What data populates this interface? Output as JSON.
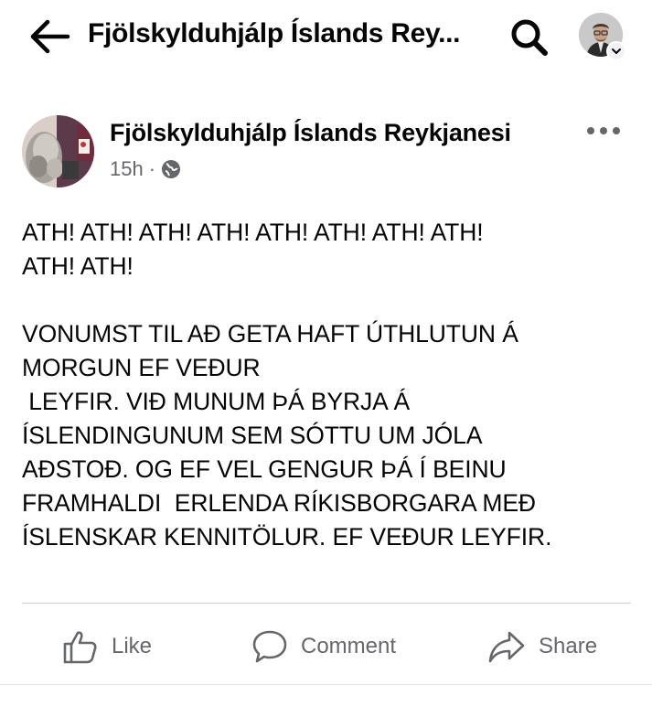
{
  "header": {
    "title": "Fjölskylduhjálp Íslands Rey...",
    "back_icon": "arrow-left-icon",
    "search_icon": "search-icon",
    "profile_icon": "avatar"
  },
  "post": {
    "page_name": "Fjölskylduhjálp Íslands Reykjanesi",
    "time": "15h",
    "separator": "·",
    "audience_icon": "globe-icon",
    "more_icon": "more-horizontal-icon",
    "body": "ATH! ATH! ATH! ATH! ATH! ATH! ATH! ATH!\nATH! ATH!\n\nVONUMST TIL AÐ GETA HAFT ÚTHLUTUN Á\nMORGUN EF VEÐUR\n LEYFIR. VIÐ MUNUM ÞÁ BYRJA Á\nÍSLENDINGUNUM SEM SÓTTU UM JÓLA\nAÐSTOÐ. OG EF VEL GENGUR ÞÁ Í BEINU\nFRAMHALDI  ERLENDA RÍKISBORGARA MEÐ\nÍSLENSKAR KENNITÖLUR. EF VEÐUR LEYFIR."
  },
  "actions": {
    "like_label": "Like",
    "comment_label": "Comment",
    "share_label": "Share"
  },
  "colors": {
    "text": "#050505",
    "secondary": "#65676b",
    "divider": "#ced0d4"
  }
}
